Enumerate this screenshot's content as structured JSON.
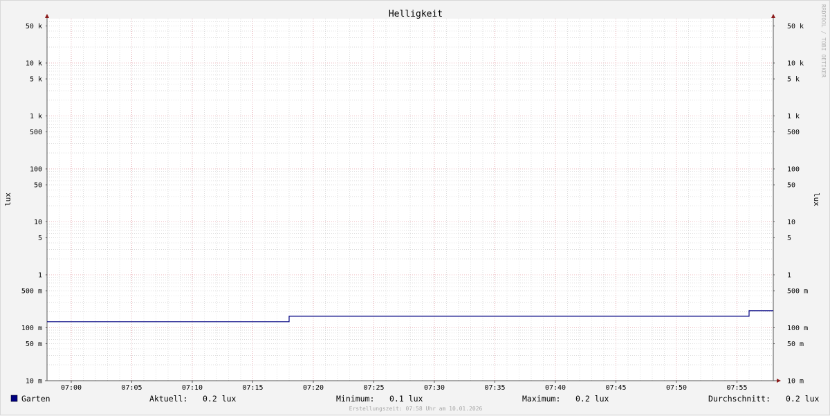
{
  "chart_data": {
    "type": "line",
    "title": "Helligkeit",
    "ylabel_left": "lux",
    "ylabel_right": "lux",
    "y_scale": "log",
    "ylim": [
      10,
      70000
    ],
    "y_ticks": [
      {
        "value": 0.01,
        "label": "10 m"
      },
      {
        "value": 0.05,
        "label": "50 m"
      },
      {
        "value": 0.1,
        "label": "100 m"
      },
      {
        "value": 0.5,
        "label": "500 m"
      },
      {
        "value": 1,
        "label": "1"
      },
      {
        "value": 5,
        "label": "5"
      },
      {
        "value": 10,
        "label": "10"
      },
      {
        "value": 50,
        "label": "50"
      },
      {
        "value": 100,
        "label": "100"
      },
      {
        "value": 500,
        "label": "500"
      },
      {
        "value": 1000,
        "label": "1 k"
      },
      {
        "value": 5000,
        "label": "5 k"
      },
      {
        "value": 10000,
        "label": "10 k"
      },
      {
        "value": 50000,
        "label": "50 k"
      }
    ],
    "xlim": [
      "06:58",
      "07:58"
    ],
    "x_ticks": [
      "07:00",
      "07:05",
      "07:10",
      "07:15",
      "07:20",
      "07:25",
      "07:30",
      "07:35",
      "07:40",
      "07:45",
      "07:50",
      "07:55"
    ],
    "grid": true,
    "series": [
      {
        "name": "Garten",
        "color": "#000080",
        "x": [
          "06:58",
          "07:18",
          "07:18",
          "07:56",
          "07:56",
          "07:58"
        ],
        "y": [
          0.13,
          0.13,
          0.165,
          0.165,
          0.21,
          0.21
        ]
      }
    ]
  },
  "legend": {
    "series_name": "Garten",
    "swatch_color": "#000080",
    "stats": [
      {
        "label": "Aktuell:",
        "value": "0.2 lux"
      },
      {
        "label": "Minimum:",
        "value": "0.1 lux"
      },
      {
        "label": "Maximum:",
        "value": "0.2 lux"
      },
      {
        "label": "Durchschnitt:",
        "value": "0.2 lux"
      }
    ]
  },
  "footer": "Erstellungszeit: 07:58 Uhr am 10.01.2026",
  "watermark": "RRDTOOL / TOBI OETIKER",
  "colors": {
    "background": "#f3f3f3",
    "plot_background": "#ffffff",
    "major_grid": "#e8a0a8",
    "minor_grid": "#d0d0d0",
    "axis": "#555555",
    "arrow": "#8b1a1a"
  }
}
